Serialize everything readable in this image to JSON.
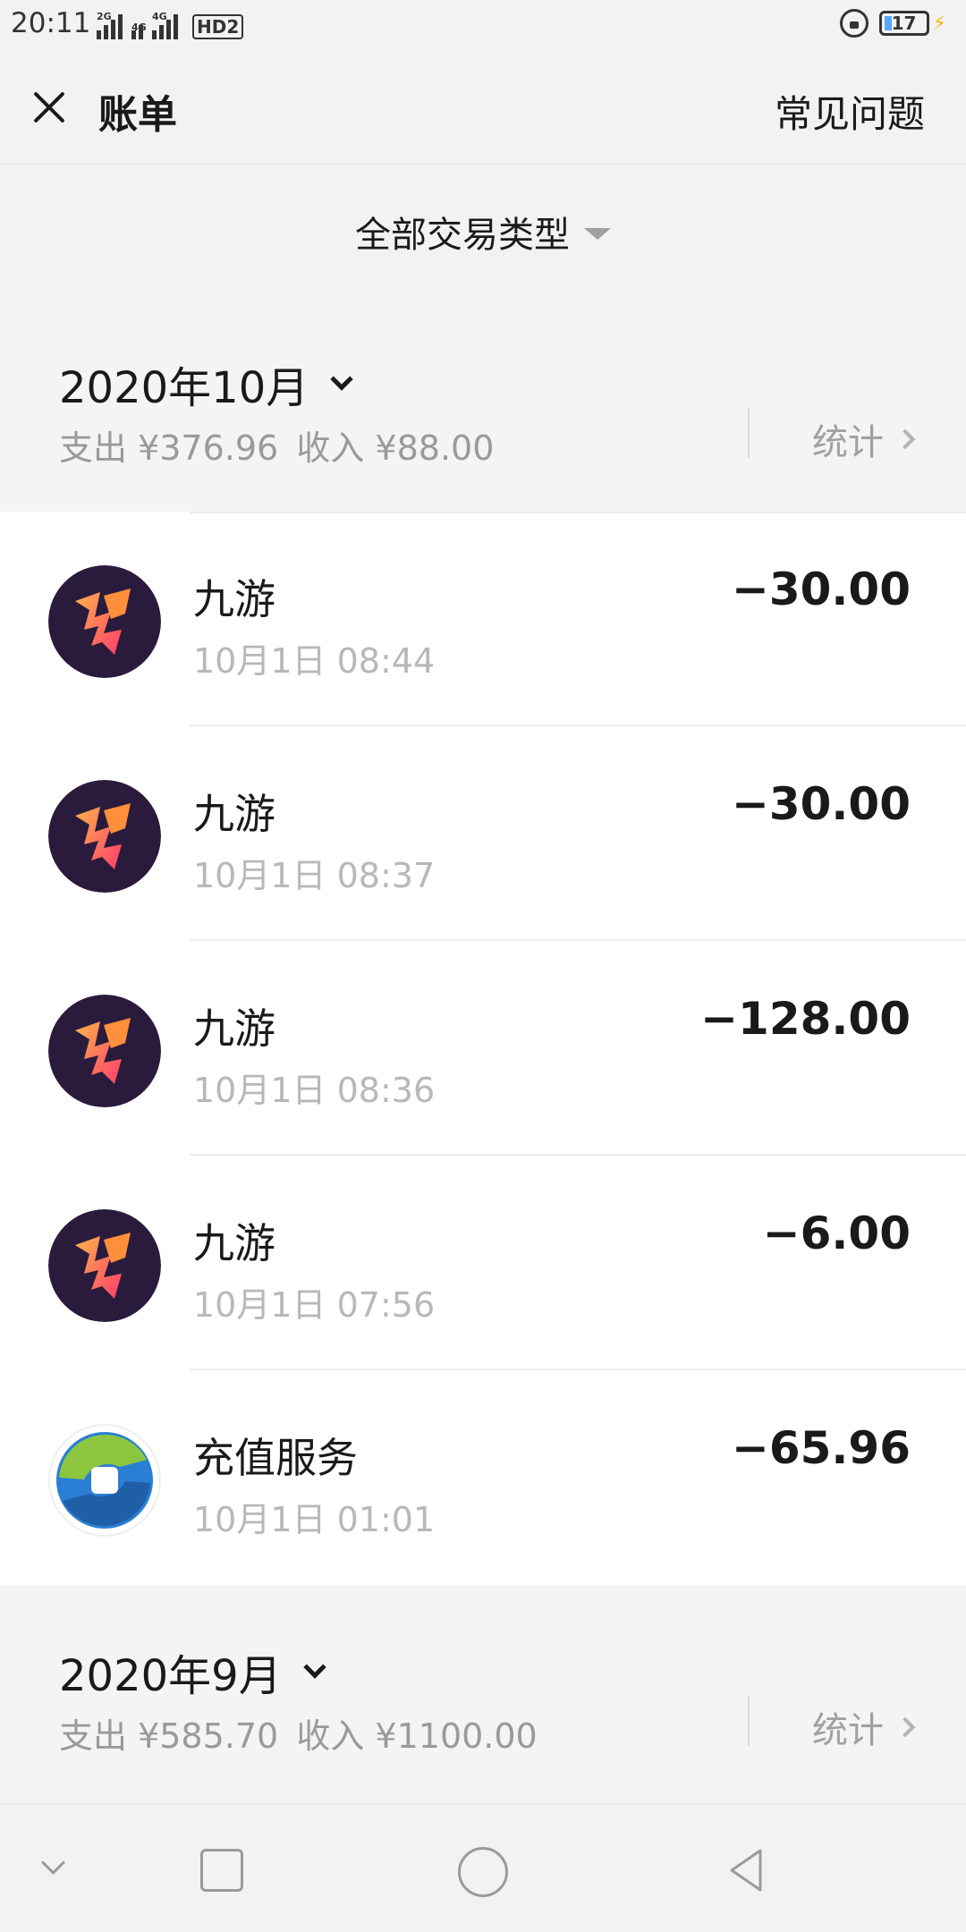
{
  "status_bar": {
    "time": "20:11",
    "signals": [
      "2G",
      "4G",
      "4G"
    ],
    "hd_label": "HD2",
    "battery_level": "17",
    "charging": true
  },
  "header": {
    "close_icon": "close-icon",
    "title": "账单",
    "faq_label": "常见问题"
  },
  "filter": {
    "label": "全部交易类型"
  },
  "months": [
    {
      "title": "2020年10月",
      "expense": "支出 ¥376.96",
      "income": "收入 ¥88.00",
      "stats_label": "统计"
    },
    {
      "title": "2020年9月",
      "expense": "支出 ¥585.70",
      "income": "收入 ¥1100.00",
      "stats_label": "统计"
    }
  ],
  "transactions": [
    {
      "name": "九游",
      "time": "10月1日 08:44",
      "amount": "−30.00",
      "icon": "jiuyou-logo"
    },
    {
      "name": "九游",
      "time": "10月1日 08:37",
      "amount": "−30.00",
      "icon": "jiuyou-logo"
    },
    {
      "name": "九游",
      "time": "10月1日 08:36",
      "amount": "−128.00",
      "icon": "jiuyou-logo"
    },
    {
      "name": "九游",
      "time": "10月1日 07:56",
      "amount": "−6.00",
      "icon": "jiuyou-logo"
    },
    {
      "name": "充值服务",
      "time": "10月1日 01:01",
      "amount": "−65.96",
      "icon": "recharge-logo"
    }
  ],
  "colors": {
    "background": "#f2f2f2",
    "jiuyou_bg": "#2a1b3d",
    "jiuyou_accent": "#ff7a3a"
  }
}
